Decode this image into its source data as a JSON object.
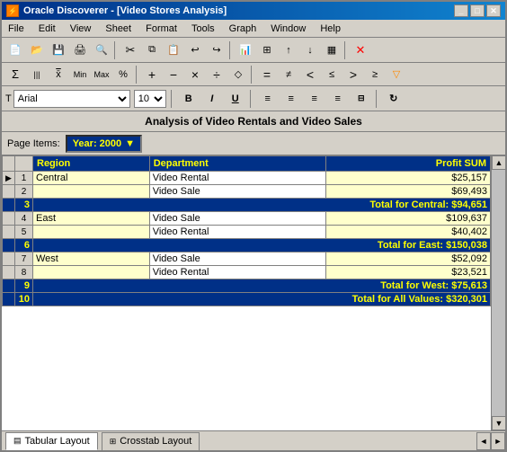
{
  "window": {
    "title": "Oracle Discoverer - [Video Stores Analysis]"
  },
  "menu": {
    "items": [
      "File",
      "Edit",
      "View",
      "Sheet",
      "Format",
      "Tools",
      "Graph",
      "Window",
      "Help"
    ]
  },
  "toolbar3": {
    "font": "Arial",
    "size": "10",
    "bold": "B",
    "italic": "I",
    "underline": "U"
  },
  "report": {
    "title": "Analysis of Video Rentals and Video Sales",
    "page_items_label": "Page Items:",
    "year_label": "Year: 2000"
  },
  "table": {
    "headers": [
      "Region",
      "Department",
      "Profit SUM"
    ],
    "rows": [
      {
        "num": "1",
        "region": "Central",
        "dept": "Video Rental",
        "profit": "$25,157"
      },
      {
        "num": "2",
        "region": "",
        "dept": "Video Sale",
        "profit": "$69,493"
      },
      {
        "num": "3",
        "type": "total",
        "label": "Total for Central: $94,651"
      },
      {
        "num": "4",
        "region": "East",
        "dept": "Video Sale",
        "profit": "$109,637"
      },
      {
        "num": "5",
        "region": "",
        "dept": "Video Rental",
        "profit": "$40,402"
      },
      {
        "num": "6",
        "type": "total",
        "label": "Total for East: $150,038"
      },
      {
        "num": "7",
        "region": "West",
        "dept": "Video Sale",
        "profit": "$52,092"
      },
      {
        "num": "8",
        "region": "",
        "dept": "Video Rental",
        "profit": "$23,521"
      },
      {
        "num": "9",
        "type": "total",
        "label": "Total for West: $75,613"
      },
      {
        "num": "10",
        "type": "grandtotal",
        "label": "Total for All Values: $320,301"
      }
    ]
  },
  "tabs": [
    {
      "label": "Tabular Layout",
      "active": true
    },
    {
      "label": "Crosstab Layout",
      "active": false
    }
  ],
  "colors": {
    "header_bg": "#003087",
    "header_text": "#ffff00",
    "data_bg": "#ffffcc",
    "total_bg": "#003087",
    "total_text": "#ffff00"
  }
}
